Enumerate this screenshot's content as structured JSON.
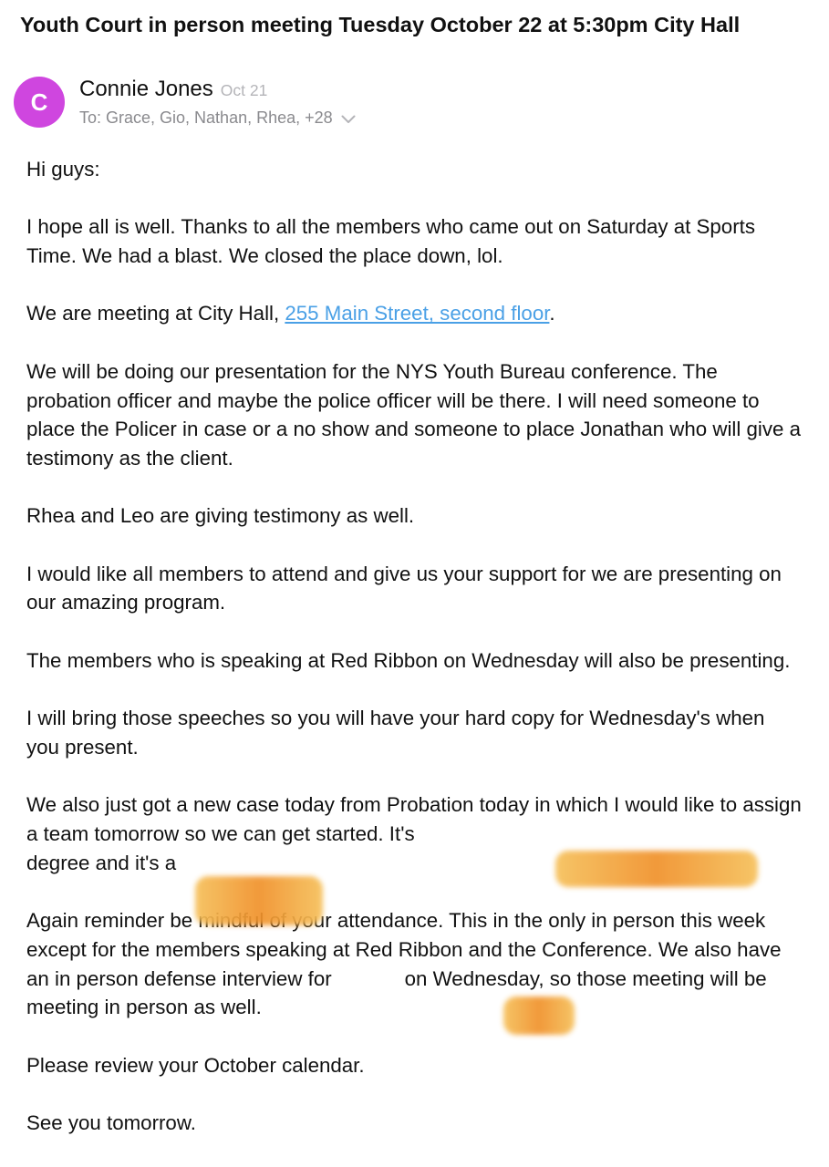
{
  "email": {
    "subject": "Youth Court in person meeting Tuesday October 22 at 5:30pm City Hall",
    "sender": {
      "initial": "C",
      "name": "Connie Jones",
      "date": "Oct 21",
      "avatar_color": "#cf46df"
    },
    "recipients": "To: Grace, Gio, Nathan, Rhea, +28",
    "recipients_icon": "chevron-down-icon",
    "body": {
      "greeting": "Hi guys:",
      "p1": "I hope all is well. Thanks to all the members who came out on Saturday at Sports Time. We had a blast. We closed the place down, lol.",
      "p2_prefix": "We are meeting at City Hall, ",
      "p2_link": "255 Main Street, second floor",
      "p2_suffix": ".",
      "p3": "We will be doing our presentation for the NYS Youth Bureau conference. The probation officer and maybe the police officer will be there. I will need someone to place the Policer in case or a no show and someone to place Jonathan who will give a testimony as the client.",
      "p4": "Rhea and Leo are giving testimony as well.",
      "p5": "I would like all members to attend and give us your support for we are presenting on our amazing program.",
      "p6": "The members who is speaking at Red Ribbon on Wednesday will also be presenting.",
      "p7": "I will bring those speeches so you will have your hard copy for Wednesday's when you present.",
      "p8_part1": "We also just got a new case today from Probation today in which I would like to assign a team tomorrow so we can get started. It's",
      "p8_part2": "degree and it's a",
      "p9_part1": "Again reminder be mindful of your attendance. This in the only in person this week except for the members speaking at Red Ribbon and the Conference. We also have an in person defense interview for",
      "p9_part2": "on Wednesday, so those meeting will be meeting in person as well.",
      "p10": "Please review your October calendar.",
      "p11": "See you tomorrow."
    },
    "link_color": "#4aa0e6",
    "redaction_color": "#f0912a"
  }
}
